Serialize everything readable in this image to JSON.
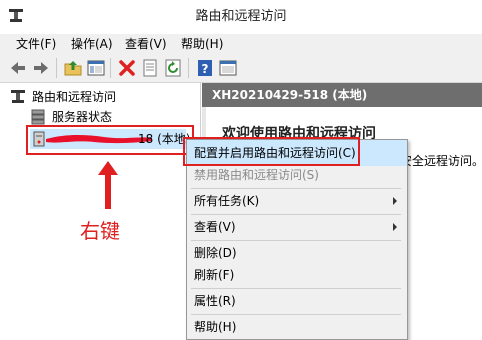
{
  "window": {
    "title": "路由和远程访问"
  },
  "menu": [
    "文件(F)",
    "操作(A)",
    "查看(V)",
    "帮助(H)"
  ],
  "toolbar_icons": [
    "back-icon",
    "forward-icon",
    "up-folder-icon",
    "show-hide-tree-icon",
    "delete-icon",
    "properties-icon",
    "refresh-icon",
    "help-icon",
    "console-icon"
  ],
  "tree": {
    "root": "路由和远程访问",
    "items": [
      {
        "label": "服务器状态",
        "icon": "server-status-icon"
      },
      {
        "label": "18 (本地)",
        "icon": "server-icon"
      }
    ]
  },
  "right": {
    "header": "XH20210429-518 (本地)",
    "welcome": "欢迎使用路由和远程访问",
    "partial": "安全远程访问。"
  },
  "context_menu": {
    "items": [
      {
        "label": "配置并启用路由和远程访问(C)",
        "disabled": false,
        "submenu": false
      },
      {
        "label": "禁用路由和远程访问(S)",
        "disabled": true,
        "submenu": false
      },
      {
        "label": "所有任务(K)",
        "disabled": false,
        "submenu": true
      },
      {
        "label": "查看(V)",
        "disabled": false,
        "submenu": true
      },
      {
        "label": "删除(D)",
        "disabled": false,
        "submenu": false
      },
      {
        "label": "刷新(F)",
        "disabled": false,
        "submenu": false
      },
      {
        "label": "属性(R)",
        "disabled": false,
        "submenu": false
      },
      {
        "label": "帮助(H)",
        "disabled": false,
        "submenu": false
      }
    ]
  },
  "annotation": {
    "text": "右键",
    "color": "#e02020"
  },
  "colors": {
    "highlight_border": "#e02020",
    "header_bg": "#6e6e6e",
    "selected_bg": "#cce8ff"
  }
}
